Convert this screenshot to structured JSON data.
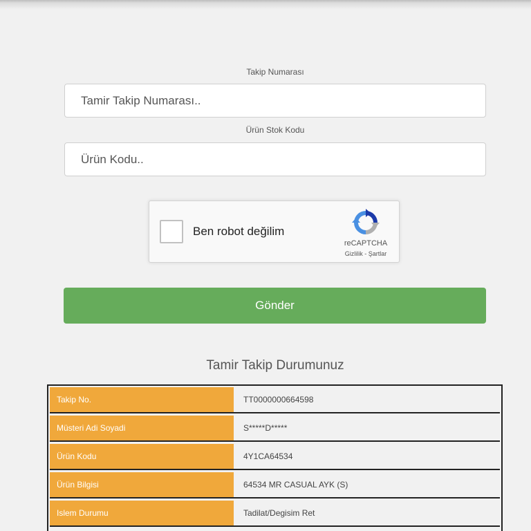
{
  "form": {
    "tracking_label": "Takip Numarası",
    "tracking_placeholder": "Tamir Takip Numarası..",
    "stock_label": "Ürün Stok Kodu",
    "stock_placeholder": "Ürün Kodu.."
  },
  "captcha": {
    "label": "Ben robot değilim",
    "brand": "reCAPTCHA",
    "privacy": "Gizlilik",
    "separator": " - ",
    "terms": "Şartlar",
    "logo_icon": "recaptcha-icon",
    "colors": {
      "blue": "#4a90e2",
      "dark_blue": "#1c3aa9",
      "gray": "#b0b0b0"
    }
  },
  "submit": {
    "label": "Gönder",
    "color": "#66ac5b"
  },
  "status": {
    "title": "Tamir Takip Durumunuz",
    "key_color": "#f0a83b",
    "rows": [
      {
        "key": "Takip No.",
        "value": "TT0000000664598"
      },
      {
        "key": "Müsteri Adi Soyadi",
        "value": "S*****D*****"
      },
      {
        "key": "Ürün Kodu",
        "value": "4Y1CA64534"
      },
      {
        "key": "Ürün Bilgisi",
        "value": "64534 MR CASUAL AYK (S)"
      },
      {
        "key": "Islem Durumu",
        "value": "Tadilat/Degisim Ret"
      }
    ]
  }
}
